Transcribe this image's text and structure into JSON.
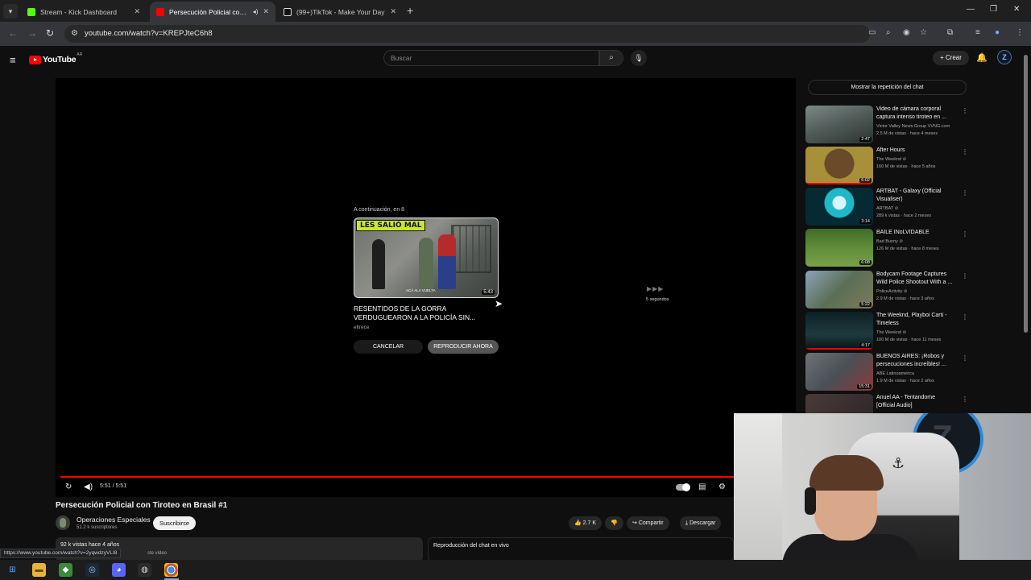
{
  "browser": {
    "tabs": [
      {
        "title": "Stream - Kick Dashboard",
        "favicon_color": "#53fc18"
      },
      {
        "title": "Persecución Policial con Tiro",
        "favicon_color": "#ff0000"
      },
      {
        "title": "(99+)TikTok - Make Your Day",
        "favicon_color": "#111111"
      }
    ],
    "url": "youtube.com/watch?v=KREPJteC6h8"
  },
  "youtube": {
    "logo_word": "YouTube",
    "country": "AR",
    "search_placeholder": "Buscar",
    "create_label": "Crear",
    "avatar_letter": "Z"
  },
  "player": {
    "upnext_label": "A continuación, en 8",
    "upnext_thumb_banner": "LES SALIÓ MAL",
    "upnext_thumb_caption": "ACÁ ALA VUELTA",
    "upnext_duration": "5:43",
    "upnext_title": "RESENTIDOS DE LA GORRA VERDUGUEARON A LA POLICÍA SIN...",
    "upnext_channel": "eltrece",
    "cancel_label": "CANCELAR",
    "play_now_label": "REPRODUCIR AHORA",
    "skip_label": "5 segundos",
    "time": "5:51 / 5:51",
    "progress": 1.0
  },
  "video": {
    "title": "Persecución Policial con Tiroteo en Brasil #1",
    "channel": "Operaciones Especiales",
    "subs": "51.2 k suscriptores",
    "subscribe_label": "Suscribirse",
    "likes": "2.7 K",
    "share_label": "Compartir",
    "download_label": "Descargar",
    "stats": "92 k vistas  hace 4 años",
    "desc_fragment": "ste video",
    "chat_label": "Reproducción del chat en vivo",
    "status_url": "https://www.youtube.com/watch?v=2yqwdzyVLI8"
  },
  "sidebar": {
    "chat_replay_label": "Mostrar la repetición del chat",
    "recs": [
      {
        "title": "Video de cámara corporal captura intenso tiroteo en ...",
        "channel": "Victor Valley News Group VVNG.com",
        "meta": "2.5 M de vistas · hace 4 meses",
        "duration": "2:47"
      },
      {
        "title": "After Hours",
        "channel": "The Weeknd ⊘",
        "meta": "160 M de vistas · hace 5 años",
        "duration": "6:02"
      },
      {
        "title": "ARTBAT - Galaxy (Official Visualiser)",
        "channel": "ARTBAT ⊘",
        "meta": "289 k vistas · hace 2 meses",
        "duration": "3:14"
      },
      {
        "title": "BAILE INoLVIDABLE",
        "channel": "Bad Bunny ⊘",
        "meta": "126 M de vistas · hace 8 meses",
        "duration": "6:08"
      },
      {
        "title": "Bodycam Footage Captures Wild Police Shootout With a ...",
        "channel": "PoliceActivity ⊘",
        "meta": "2.9 M de vistas · hace 3 años",
        "duration": "5:22"
      },
      {
        "title": "The Weeknd, Playboi Carti - Timeless",
        "channel": "The Weeknd ⊘",
        "meta": "100 M de vistas · hace 11 meses",
        "duration": "4:17"
      },
      {
        "title": "BUENOS AIRES: ¡Robos y persecuciones increíbles! ...",
        "channel": "ABE Latinoamérica",
        "meta": "1.9 M de vistas · hace 2 años",
        "duration": "15:31"
      },
      {
        "title": "Anuel AA - Tentandome [Official Audio]",
        "channel": "",
        "meta": "",
        "duration": ""
      }
    ]
  },
  "colors": {
    "accent": "#ff0000",
    "background": "#0f0f0f",
    "webcam_ring": "#2d8bd8"
  }
}
